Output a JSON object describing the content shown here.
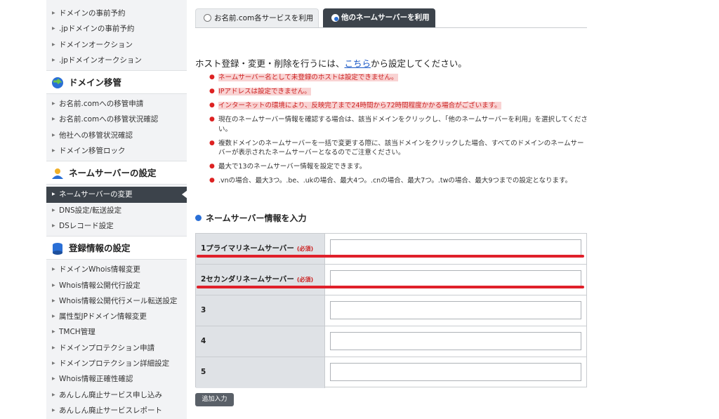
{
  "sidebar": {
    "group1_items": [
      {
        "label": "ドメインの事前予約"
      },
      {
        "label": ".jpドメインの事前予約"
      },
      {
        "label": "ドメインオークション"
      },
      {
        "label": ".jpドメインオークション"
      }
    ],
    "transfer": {
      "title": "ドメイン移管",
      "items": [
        {
          "label": "お名前.comへの移管申請"
        },
        {
          "label": "お名前.comへの移管状況確認"
        },
        {
          "label": "他社への移管状況確認"
        },
        {
          "label": "ドメイン移管ロック"
        }
      ]
    },
    "nameserver": {
      "title": "ネームサーバーの設定",
      "items": [
        {
          "label": "ネームサーバーの変更",
          "active": true
        },
        {
          "label": "DNS設定/転送設定"
        },
        {
          "label": "DSレコード設定"
        }
      ]
    },
    "registration": {
      "title": "登録情報の設定",
      "items": [
        {
          "label": "ドメインWhois情報変更"
        },
        {
          "label": "Whois情報公開代行設定"
        },
        {
          "label": "Whois情報公開代行メール転送設定"
        },
        {
          "label": "属性型JPドメイン情報変更"
        },
        {
          "label": "TMCH管理"
        },
        {
          "label": "ドメインプロテクション申請"
        },
        {
          "label": "ドメインプロテクション詳細設定"
        },
        {
          "label": "Whois情報正確性確認"
        },
        {
          "label": "あんしん廃止サービス申し込み"
        },
        {
          "label": "あんしん廃止サービスレポート"
        }
      ]
    }
  },
  "tabs": [
    {
      "label": "お名前.com各サービスを利用",
      "selected": false
    },
    {
      "label": "他のネームサーバーを利用",
      "selected": true
    }
  ],
  "intro": {
    "before": "ホスト登録・変更・削除を行うには、",
    "link": "こちら",
    "after": "から設定してください。"
  },
  "notes": [
    {
      "text": "ネームサーバー名として未登録のホストは設定できません。",
      "highlight": true
    },
    {
      "text": "IPアドレスは設定できません。",
      "highlight": true
    },
    {
      "text": "インターネットの環境により、反映完了まで24時間から72時間程度かかる場合がございます。",
      "highlight": true
    },
    {
      "text": "現在のネームサーバー情報を確認する場合は、該当ドメインをクリックし、「他のネームサーバーを利用」を選択してください。",
      "highlight": false
    },
    {
      "text": "複数ドメインのネームサーバーを一括で変更する際に、該当ドメインをクリックした場合、すべてのドメインのネームサーバーが表示されたネームサーバーとなるのでご注意ください。",
      "highlight": false
    },
    {
      "text": "最大で13のネームサーバー情報を設定できます。",
      "highlight": false
    },
    {
      "text": ".vnの場合、最大3つ。.be、.ukの場合、最大4つ。.cnの場合、最大7つ。.twの場合、最大9つまでの設定となります。",
      "highlight": false
    }
  ],
  "form": {
    "title": "ネームサーバー情報を入力",
    "rows": [
      {
        "label": "1プライマリネームサーバー",
        "required": "(必須)",
        "value": ""
      },
      {
        "label": "2セカンダリネームサーバー",
        "required": "(必須)",
        "value": ""
      },
      {
        "label": "3",
        "required": "",
        "value": ""
      },
      {
        "label": "4",
        "required": "",
        "value": ""
      },
      {
        "label": "5",
        "required": "",
        "value": ""
      }
    ],
    "add_button": "追加入力"
  },
  "colors": {
    "accent_blue": "#2a6fd6",
    "active_nav": "#3c434b",
    "annotation_red": "#e0202a",
    "warning_highlight": "#f9d3d3"
  }
}
